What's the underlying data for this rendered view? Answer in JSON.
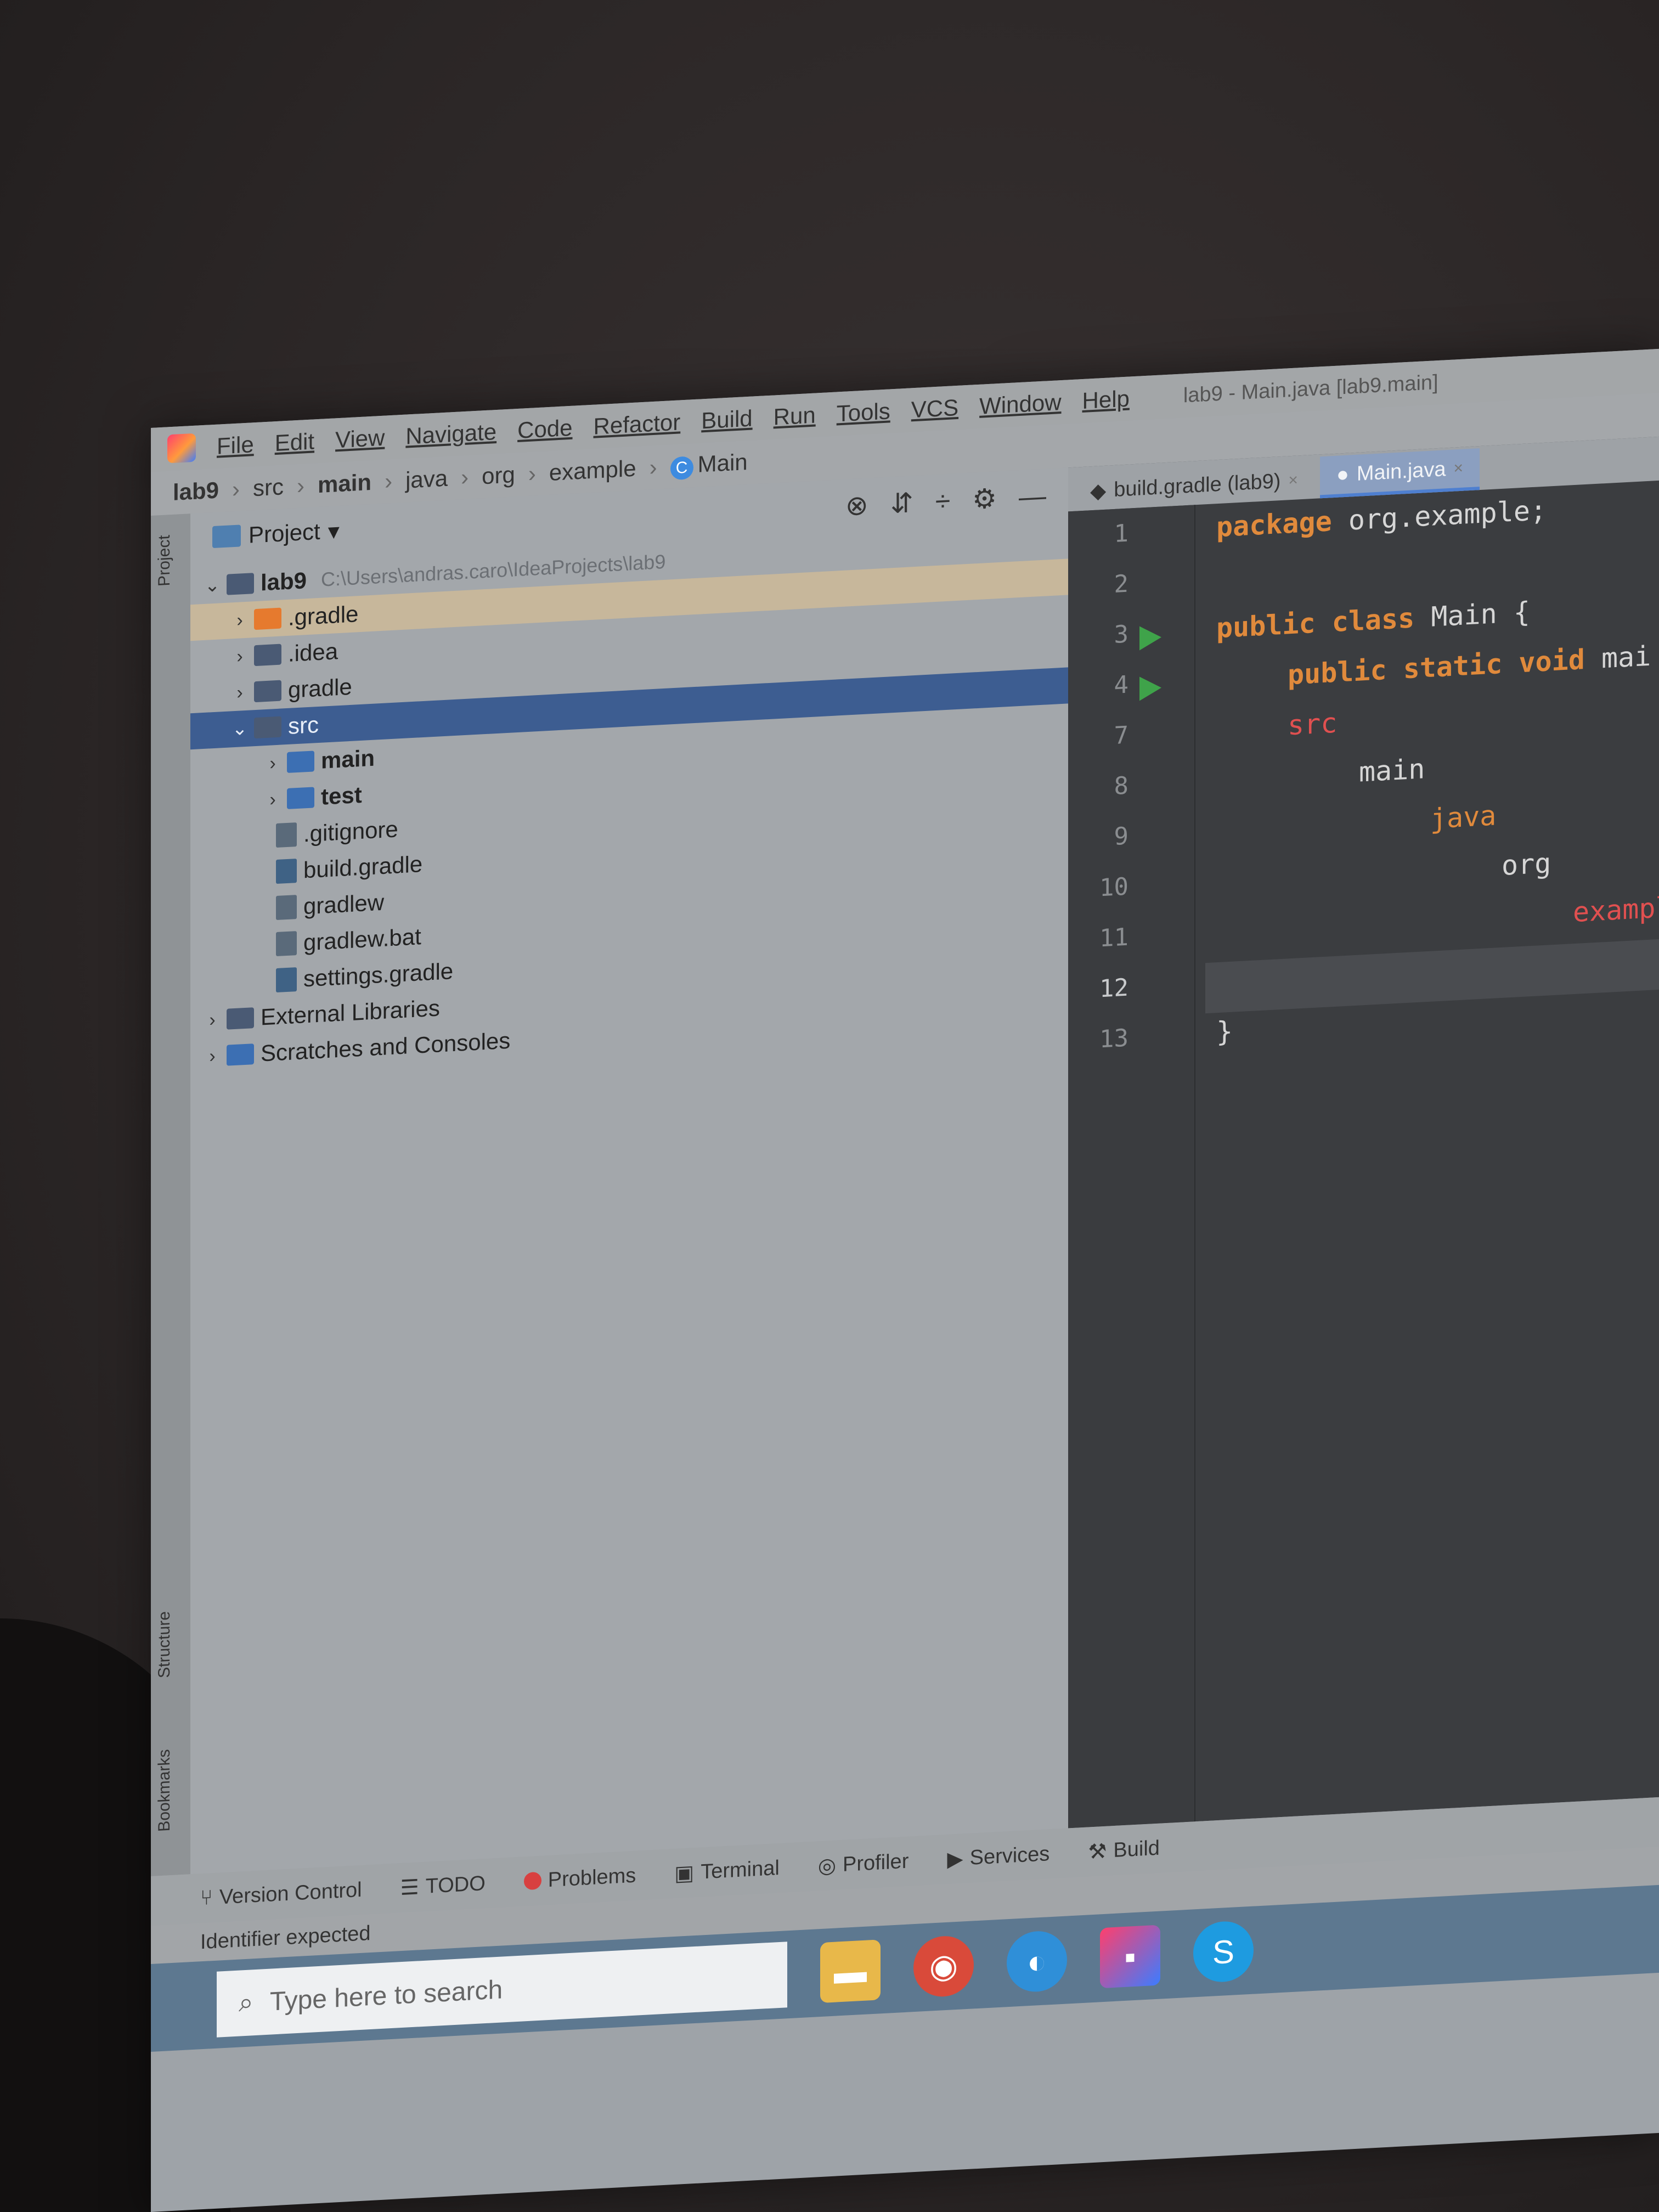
{
  "menu": {
    "items": [
      "File",
      "Edit",
      "View",
      "Navigate",
      "Code",
      "Refactor",
      "Build",
      "Run",
      "Tools",
      "VCS",
      "Window",
      "Help"
    ],
    "window_title": "lab9 - Main.java [lab9.main]"
  },
  "breadcrumb": [
    "lab9",
    "src",
    "main",
    "java",
    "org",
    "example",
    "Main"
  ],
  "project_panel": {
    "title": "Project",
    "root_label": "lab9",
    "root_path": "C:\\Users\\andras.caro\\IdeaProjects\\lab9",
    "items": [
      {
        "label": ".gradle"
      },
      {
        "label": ".idea"
      },
      {
        "label": "gradle"
      },
      {
        "label": "src"
      },
      {
        "label": "main"
      },
      {
        "label": "test"
      },
      {
        "label": ".gitignore"
      },
      {
        "label": "build.gradle"
      },
      {
        "label": "gradlew"
      },
      {
        "label": "gradlew.bat"
      },
      {
        "label": "settings.gradle"
      },
      {
        "label": "External Libraries"
      },
      {
        "label": "Scratches and Consoles"
      }
    ]
  },
  "side_tabs": {
    "project": "Project",
    "structure": "Structure",
    "bookmarks": "Bookmarks"
  },
  "editor": {
    "tabs": [
      {
        "label": "build.gradle (lab9)"
      },
      {
        "label": "Main.java"
      }
    ],
    "line_numbers": [
      "1",
      "2",
      "3",
      "4",
      "7",
      "8",
      "9",
      "10",
      "11",
      "12",
      "13"
    ],
    "code": {
      "l1_kw": "package",
      "l1_rest": " org.example;",
      "l3_kw": "public class",
      "l3_rest": " Main {",
      "l4_kw": "public static void",
      "l4_rest": " mai",
      "l7": "src",
      "l8": "main",
      "l9": "java",
      "l10": "org",
      "l11": "exampl",
      "l13": "}"
    }
  },
  "bottom_tools": [
    "Version Control",
    "TODO",
    "Problems",
    "Terminal",
    "Profiler",
    "Services",
    "Build"
  ],
  "status": "Identifier expected",
  "taskbar": {
    "search_placeholder": "Type here to search"
  }
}
